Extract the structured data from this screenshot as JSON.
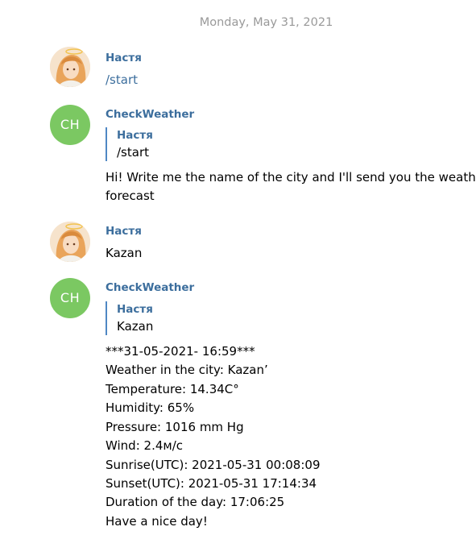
{
  "date_header": "Monday, May 31, 2021",
  "messages": [
    {
      "sender": "Настя",
      "avatar_icon": "user-photo-avatar",
      "text": "/start"
    },
    {
      "sender": "CheckWeather",
      "avatar_initials": "CH",
      "avatar_color": "#7bc862",
      "reply": {
        "sender": "Настя",
        "text": "/start"
      },
      "lines": [
        "Hi! Write me the name of the city and I'll send you the weather",
        "forecast"
      ]
    },
    {
      "sender": "Настя",
      "avatar_icon": "user-photo-avatar",
      "text": "Kazan"
    },
    {
      "sender": "CheckWeather",
      "avatar_initials": "CH",
      "avatar_color": "#7bc862",
      "reply": {
        "sender": "Настя",
        "text": "Kazan"
      },
      "lines": [
        "***31-05-2021- 16:59***",
        "Weather in the city: Kazan’",
        "Temperature: 14.34C°",
        "Humidity: 65%",
        "Pressure: 1016 mm Hg",
        "Wind: 2.4м/с",
        "Sunrise(UTC): 2021-05-31 00:08:09",
        "Sunset(UTC): 2021-05-31 17:14:34",
        "Duration of the day: 17:06:25",
        "Have a nice day!"
      ]
    }
  ],
  "colors": {
    "sender_name": "#3c6e9d",
    "quote_bar": "#4f87c4",
    "date_text": "#999999",
    "bot_avatar": "#7bc862"
  }
}
